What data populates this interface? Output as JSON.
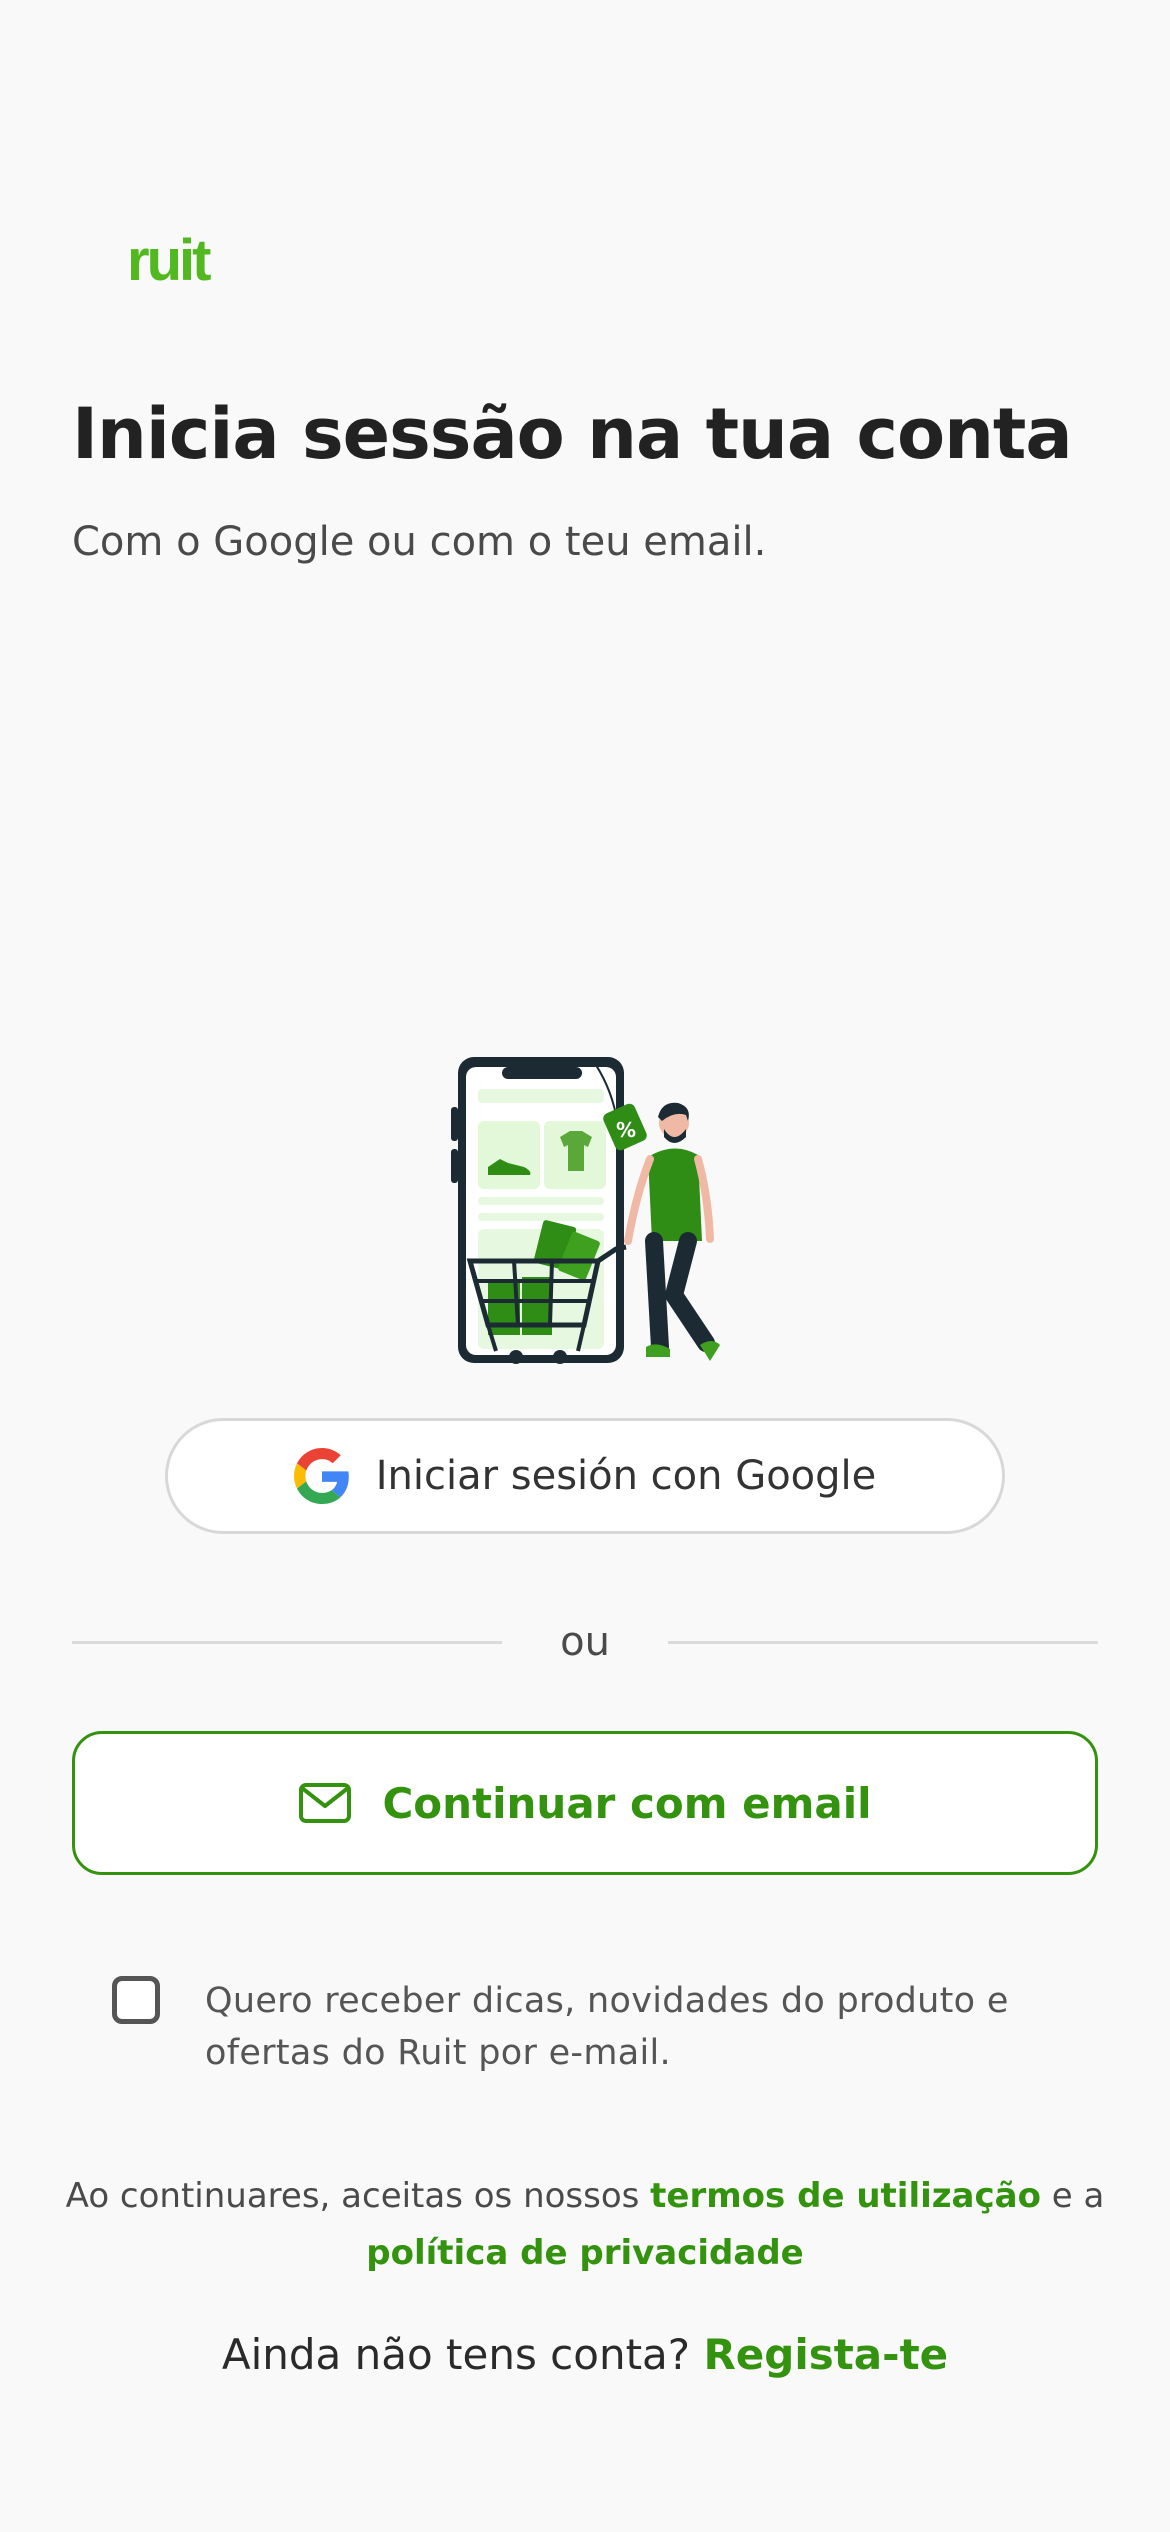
{
  "brand": {
    "logo_text": "ruit",
    "accent_color": "#33920e",
    "logo_color": "#52b81f"
  },
  "header": {
    "title": "Inicia sessão na tua conta",
    "subtitle": "Com o Google ou com o teu email."
  },
  "illustration": {
    "description_icon": "shopping-illustration-icon",
    "tag_text": "%"
  },
  "google_button": {
    "icon": "google-logo-icon",
    "label": "Iniciar sesión con Google"
  },
  "divider": {
    "text": "ou"
  },
  "email_button": {
    "icon": "mail-icon",
    "label": "Continuar com email"
  },
  "newsletter": {
    "checked": false,
    "label": "Quero receber dicas, novidades do produto e ofertas do Ruit por e-mail."
  },
  "legal": {
    "prefix": "Ao continuares, aceitas os nossos ",
    "terms_link": "termos de utilização",
    "middle": " e a ",
    "privacy_link": "política de privacidade"
  },
  "signup": {
    "prompt": "Ainda não tens conta? ",
    "link": "Regista-te"
  }
}
